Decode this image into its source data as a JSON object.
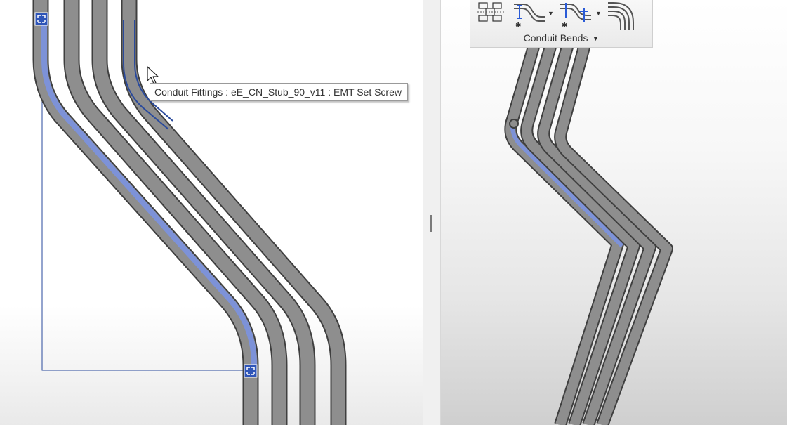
{
  "tooltip": {
    "text": "Conduit Fittings : eE_CN_Stub_90_v11 : EMT Set Screw"
  },
  "ribbon": {
    "panel_title": "Conduit Bends",
    "tools": [
      {
        "icon": "conduit-grid-icon"
      },
      {
        "icon": "offset-bend-icon"
      },
      {
        "icon": "kick-bend-icon"
      },
      {
        "icon": "multi-bend-icon"
      }
    ]
  },
  "colors": {
    "conduit": "#8e8e8e",
    "conduit_outline": "#3f3f3f",
    "selected": "#7d92d8",
    "selection_box": "#2a4a9c"
  },
  "icons": {
    "cursor": "arrow-pointer-icon",
    "grip": "grip-handle-icon",
    "splitter": "splitter-grip-icon"
  }
}
